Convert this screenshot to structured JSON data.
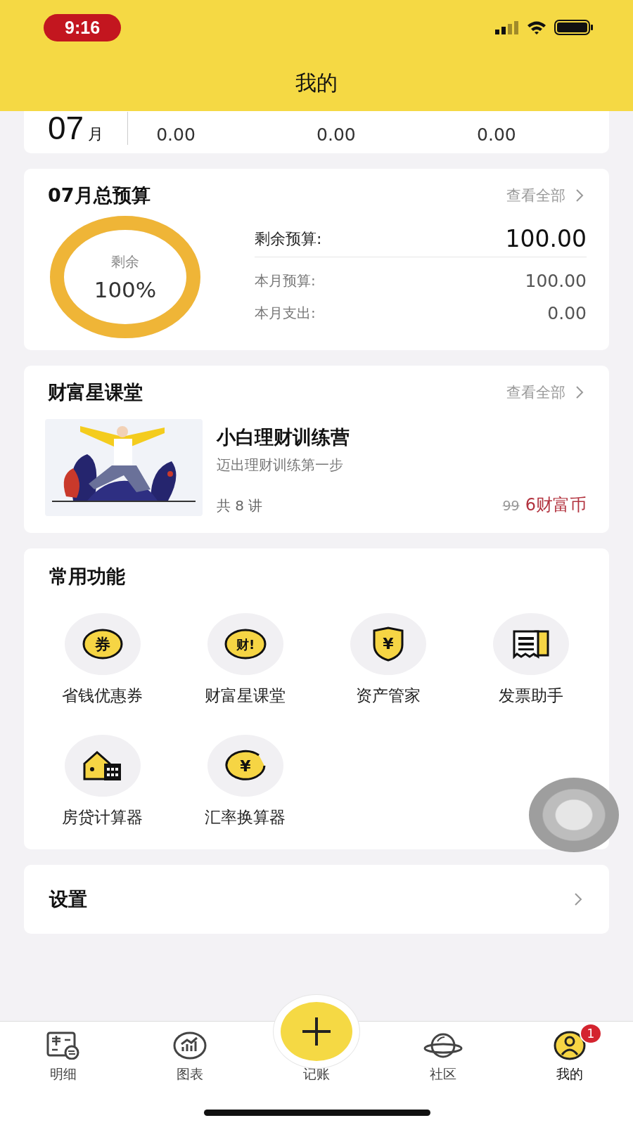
{
  "status_bar": {
    "time": "9:16"
  },
  "header": {
    "title": "我的"
  },
  "summary": {
    "month": "07",
    "unit": "月",
    "values": [
      "0.00",
      "0.00",
      "0.00"
    ]
  },
  "budget": {
    "title": "07月总预算",
    "link": "查看全部",
    "ring_label": "剩余",
    "ring_value": "100%",
    "level": 1,
    "rows": [
      {
        "label": "剩余预算:",
        "value": "100.00",
        "kind": "main"
      },
      {
        "label": "本月预算:",
        "value": "100.00",
        "kind": "sub"
      },
      {
        "label": "本月支出:",
        "value": "0.00",
        "kind": "sub"
      }
    ]
  },
  "course_section": {
    "title": "财富星课堂",
    "link": "查看全部",
    "course": {
      "kind": "picture",
      "name": "小白理财训练营",
      "subtitle": "迈出理财训练第一步",
      "lessons": "共 8 讲",
      "old_price": "99",
      "price": "6财富币"
    }
  },
  "functions": {
    "title": "常用功能",
    "items": [
      {
        "label": "省钱优惠券",
        "glyph": "券"
      },
      {
        "label": "财富星课堂",
        "glyph": "财!"
      },
      {
        "label": "资产管家",
        "glyph": "¥"
      },
      {
        "label": "发票助手"
      },
      {
        "label": "房贷计算器"
      },
      {
        "label": "汇率换算器",
        "glyph": "¥"
      }
    ]
  },
  "settings": {
    "label": "设置"
  },
  "tabs": [
    {
      "label": "明细",
      "selected": false
    },
    {
      "label": "图表",
      "selected": false
    },
    {
      "label": "记账",
      "selected": false,
      "kind": "add"
    },
    {
      "label": "社区",
      "selected": false
    },
    {
      "label": "我的",
      "selected": true,
      "badge": "1"
    }
  ]
}
